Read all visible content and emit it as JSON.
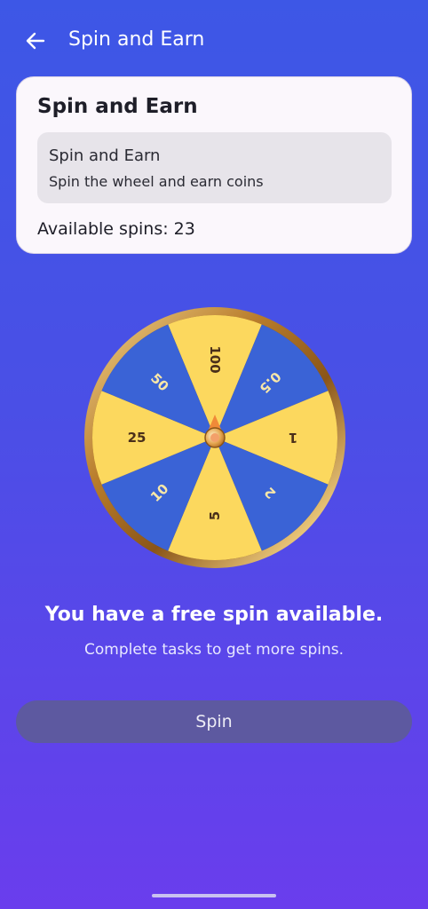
{
  "header": {
    "title": "Spin and Earn",
    "back_icon": "arrow-left-icon"
  },
  "card": {
    "title": "Spin and Earn",
    "inner_title": "Spin and Earn",
    "inner_subtitle": "Spin the wheel and earn coins",
    "available_spins": "Available spins: 23"
  },
  "wheel": {
    "segments": [
      {
        "label": "100",
        "color": "#fcd85e"
      },
      {
        "label": "0.5",
        "color": "#3a63d6"
      },
      {
        "label": "1",
        "color": "#fcd85e"
      },
      {
        "label": "2",
        "color": "#3a63d6"
      },
      {
        "label": "5",
        "color": "#fcd85e"
      },
      {
        "label": "10",
        "color": "#3a63d6"
      },
      {
        "label": "25",
        "color": "#fcd85e"
      },
      {
        "label": "50",
        "color": "#3a63d6"
      }
    ],
    "rim_color": "#c8963c",
    "pointer_icon": "pointer-icon"
  },
  "message": {
    "headline": "You have a free spin available.",
    "subline": "Complete tasks to get more spins."
  },
  "spin_button": {
    "label": "Spin"
  }
}
